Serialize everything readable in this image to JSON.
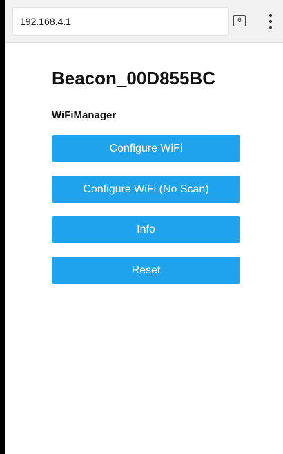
{
  "browser": {
    "url": "192.168.4.1",
    "tab_count": "6",
    "menu_icon": "more-vert-icon"
  },
  "page": {
    "title": "Beacon_00D855BC",
    "subtitle": "WiFiManager",
    "buttons": [
      {
        "label": "Configure WiFi"
      },
      {
        "label": "Configure WiFi (No Scan)"
      },
      {
        "label": "Info"
      },
      {
        "label": "Reset"
      }
    ],
    "button_color": "#1fa3ec"
  }
}
